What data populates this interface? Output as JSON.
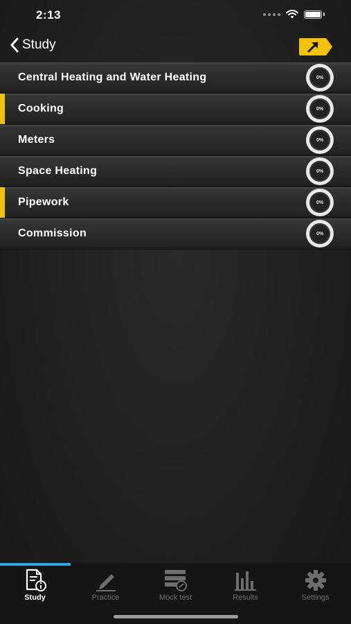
{
  "status_bar": {
    "time": "2:13"
  },
  "nav": {
    "back_label": "Study",
    "share_icon": "share-arrow-icon"
  },
  "topics": [
    {
      "label": "Central Heating and Water Heating",
      "progress": "0%",
      "progress_value": 0,
      "marked": false
    },
    {
      "label": "Cooking",
      "progress": "0%",
      "progress_value": 0,
      "marked": true
    },
    {
      "label": "Meters",
      "progress": "0%",
      "progress_value": 0,
      "marked": false
    },
    {
      "label": "Space Heating",
      "progress": "0%",
      "progress_value": 0,
      "marked": false
    },
    {
      "label": "Pipework",
      "progress": "0%",
      "progress_value": 0,
      "marked": true
    },
    {
      "label": "Commission",
      "progress": "0%",
      "progress_value": 0,
      "marked": false
    }
  ],
  "tabs": [
    {
      "label": "Study",
      "icon": "study-icon",
      "active": true
    },
    {
      "label": "Practice",
      "icon": "pencil-icon",
      "active": false
    },
    {
      "label": "Mock test",
      "icon": "mock-test-icon",
      "active": false
    },
    {
      "label": "Results",
      "icon": "bar-chart-icon",
      "active": false
    },
    {
      "label": "Settings",
      "icon": "gear-icon",
      "active": false
    }
  ],
  "colors": {
    "accent_yellow": "#f2c200",
    "tab_indicator": "#2aa9e0",
    "background": "#1d1d1d"
  }
}
